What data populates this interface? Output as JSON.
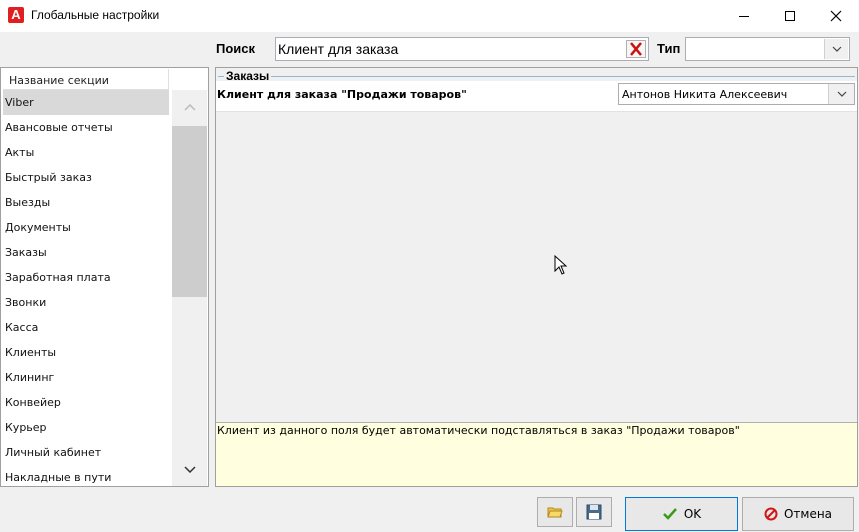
{
  "window": {
    "title": "Глобальные настройки",
    "icon": "app-logo-icon"
  },
  "search": {
    "label": "Поиск",
    "value": "Клиент для заказа",
    "clear_icon": "clear-x-icon"
  },
  "type_filter": {
    "label": "Тип",
    "value": ""
  },
  "sections": {
    "header": "Название секции",
    "selected": "Viber",
    "items": [
      "Viber",
      "Авансовые отчеты",
      "Акты",
      "Быстрый заказ",
      "Выезды",
      "Документы",
      "Заказы",
      "Заработная плата",
      "Звонки",
      "Касса",
      "Клиенты",
      "Клининг",
      "Конвейер",
      "Курьер",
      "Личный кабинет",
      "Накладные в пути"
    ]
  },
  "settings": {
    "group_title": "Заказы",
    "field_label": "Клиент для заказа \"Продажи товаров\"",
    "field_value": "Антонов Никита Алексеевич",
    "description": "Клиент из данного поля будет автоматически подставляться в заказ \"Продажи товаров\""
  },
  "buttons": {
    "ok_label": "OK",
    "cancel_label": "Отмена",
    "folder_icon": "folder-icon",
    "save_icon": "save-disk-icon"
  },
  "colors": {
    "accent": "#0078d7",
    "clear_red": "#cc1111",
    "cancel_red": "#d01818",
    "ok_green": "#3a9a1a",
    "selection": "#d9d9d9",
    "description_bg": "#ffffe0"
  }
}
